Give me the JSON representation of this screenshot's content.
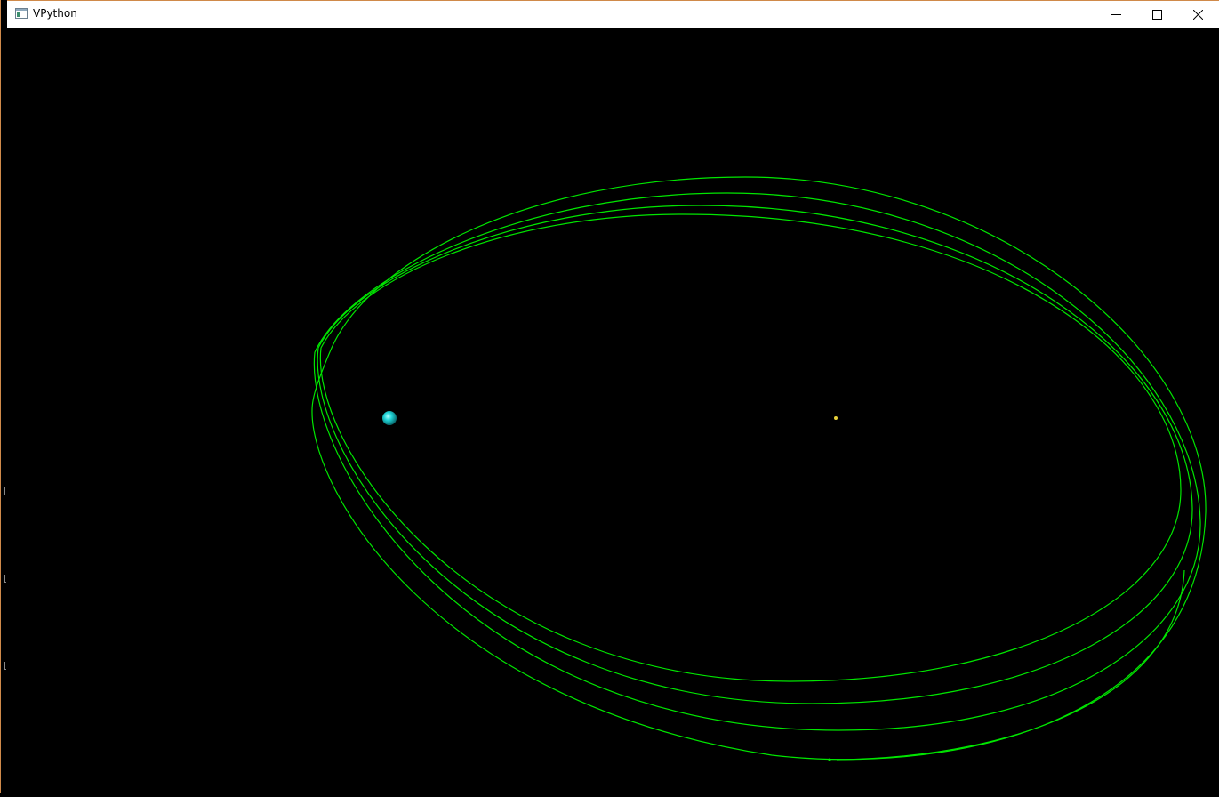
{
  "window": {
    "title": "VPython",
    "icon": "vpython-window-icon"
  },
  "controls": {
    "minimize": "minimize-icon",
    "maximize": "maximize-icon",
    "close": "close-icon"
  },
  "scene": {
    "background": "#000000",
    "orbit_color": "#00e600",
    "planet_color": "#1fd3d6",
    "star_color": "#e6d03a",
    "probe_color": "#00e600"
  }
}
